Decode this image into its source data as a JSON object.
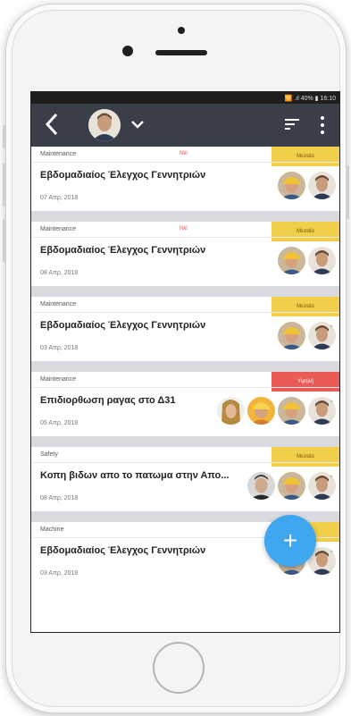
{
  "status": {
    "text": "🛜 .ıl 40% ▮ 16:10"
  },
  "appbar": {
    "back_icon": "chevron-left-icon",
    "dropdown_icon": "chevron-down-icon",
    "filter_icon": "sort-icon",
    "more_icon": "more-vert-icon"
  },
  "tasks": [
    {
      "category": "Maintenance",
      "tag": "Nkl",
      "priority": "Μεσαία",
      "title": "Εβδομαδιαίος Έλεγχος Γεννητριών",
      "date": "07 Απρ, 2018"
    },
    {
      "category": "Maintenance",
      "tag": "Nkl",
      "priority": "Μεσαία",
      "title": "Εβδομαδιαίος Έλεγχος Γεννητριών",
      "date": "08 Απρ, 2018"
    },
    {
      "category": "Maintenance",
      "tag": "",
      "priority": "Μεσαία",
      "title": "Εβδομαδιαίος Έλεγχος Γεννητριών",
      "date": "03 Απρ, 2018"
    },
    {
      "category": "Maintenance",
      "tag": "",
      "priority": "Υψηλή",
      "title": "Επιδιορθωση ραγας στο Δ31",
      "date": "05 Απρ, 2018"
    },
    {
      "category": "Safety",
      "tag": "",
      "priority": "Μεσαία",
      "title": "Κοπη βιδων απο το πατωμα στην Απο...",
      "date": "08 Απρ, 2018"
    },
    {
      "category": "Machine",
      "tag": "",
      "priority": "",
      "title": "Εβδομαδιαίος Έλεγχος Γεννητριών",
      "date": "03 Απρ, 2018"
    }
  ],
  "colors": {
    "appbar": "#3a3e47",
    "medium": "#f2cf4a",
    "high": "#e95b57",
    "fab": "#3fa7ef"
  },
  "fab": {
    "label": "+"
  }
}
